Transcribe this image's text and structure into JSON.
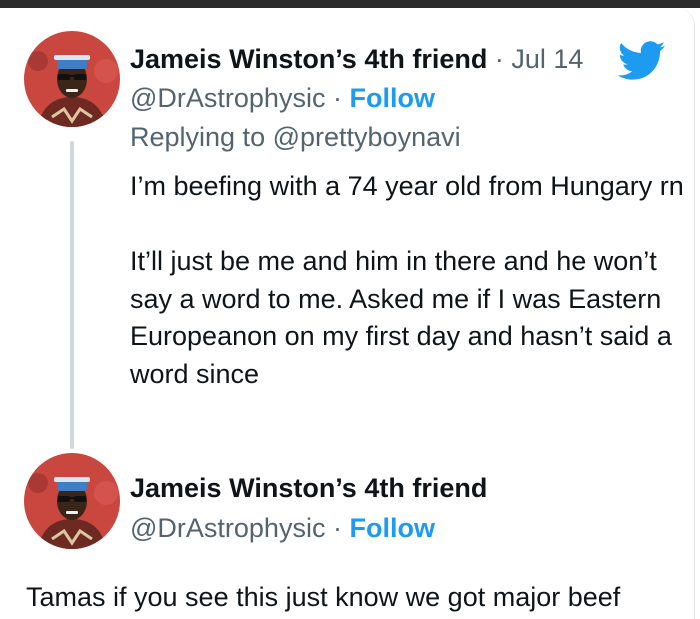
{
  "colors": {
    "brand_blue": "#1d9bf0",
    "secondary_text": "#536471",
    "primary_text": "#0f1419",
    "thread_line": "#cfd9de"
  },
  "icons": {
    "logo": "twitter-bird-icon"
  },
  "tweet1": {
    "display_name": "Jameis Winston’s 4th friend",
    "separator": "·",
    "date": "Jul 14",
    "handle": "@DrAstrophysic",
    "handle_separator": "·",
    "follow_label": "Follow",
    "replying_prefix": "Replying to",
    "replying_to": "@prettyboynavi",
    "paragraph1": "I’m beefing with a 74 year old from Hungary rn",
    "paragraph2": "It’ll just be me and him in there and he won’t say a word to me. Asked me if I was Eastern Europeanon on my first day and hasn’t said a word since"
  },
  "tweet2": {
    "display_name": "Jameis Winston’s 4th friend",
    "handle": "@DrAstrophysic",
    "handle_separator": "·",
    "follow_label": "Follow",
    "text": "Tamas if you see this just know we got major beef"
  }
}
